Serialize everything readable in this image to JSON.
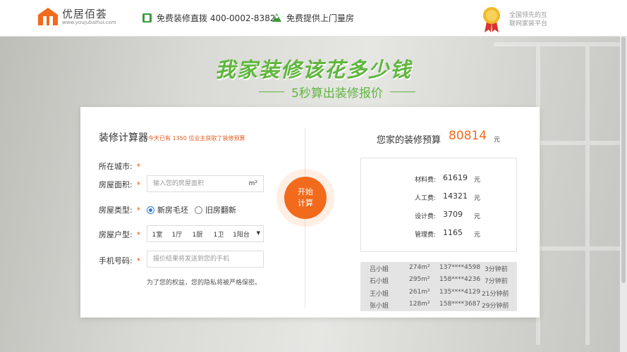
{
  "header": {
    "brand_name": "优居佰荟",
    "brand_url": "www.youjubaihui.com",
    "hotline": "免费装修直拨 400-0002-8382",
    "service": "免费提供上门量房",
    "slogan": "全国领先的互联网家装平台"
  },
  "hero": {
    "title": "我家装修该花多少钱",
    "subtitle": "5秒算出装修报价"
  },
  "calculator": {
    "title": "装修计算器",
    "subtitle": "今天已有 1350 位业主获取了装修预算",
    "city_label": "所在城市:",
    "area_label": "房屋面积:",
    "area_placeholder": "输入您的房屋面积",
    "area_unit": "m²",
    "type_label": "房屋类型:",
    "type_options": [
      "新房毛坯",
      "旧房翻新"
    ],
    "type_selected": "新房毛坯",
    "layout_label": "房屋户型:",
    "layout_values": [
      "1室",
      "1厅",
      "1厨",
      "1卫",
      "1阳台"
    ],
    "phone_label": "手机号码:",
    "phone_placeholder": "报价结果将发送到您的手机",
    "privacy": "为了您的权益，您的隐私将被严格保密。",
    "start_button": [
      "开始",
      "计算"
    ],
    "required_mark": "*"
  },
  "result": {
    "budget_label": "您家的装修预算",
    "budget_value": "80814",
    "budget_unit": "元",
    "fees": [
      {
        "label": "材料费:",
        "value": "61619",
        "unit": "元"
      },
      {
        "label": "人工费:",
        "value": "14321",
        "unit": "元"
      },
      {
        "label": "设计费:",
        "value": "3709",
        "unit": "元"
      },
      {
        "label": "管理费:",
        "value": "1165",
        "unit": "元"
      }
    ],
    "recent": [
      {
        "name": "吕小姐",
        "area": "274m²",
        "phone": "137****4598",
        "time": "3分钟前"
      },
      {
        "name": "石小姐",
        "area": "295m²",
        "phone": "158****4236",
        "time": "7分钟前"
      },
      {
        "name": "王小姐",
        "area": "261m²",
        "phone": "135****4129",
        "time": "21分钟前"
      },
      {
        "name": "张小姐",
        "area": "128m²",
        "phone": "158****3687",
        "time": "29分钟前"
      }
    ]
  },
  "colors": {
    "brand": "#f26a1b",
    "green": "#5fb63d"
  },
  "icons": [
    "house-logo-icon",
    "phone-icon",
    "measure-icon",
    "medal-icon",
    "chevron-down-icon"
  ]
}
